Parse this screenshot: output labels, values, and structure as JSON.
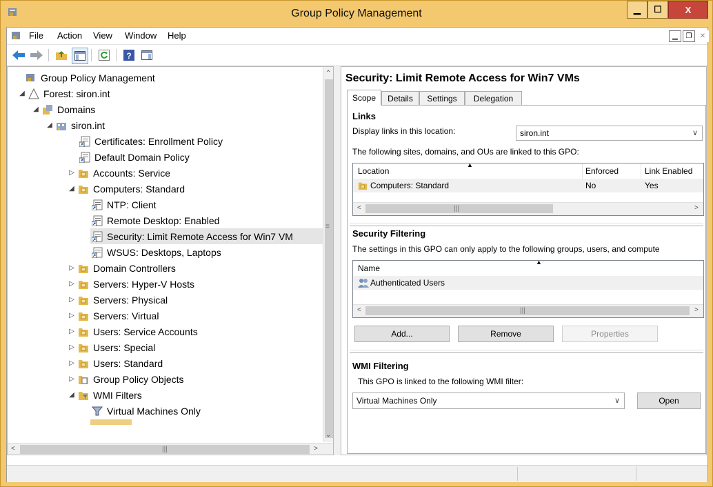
{
  "window": {
    "title": "Group Policy Management"
  },
  "menu": {
    "items": [
      {
        "label": "File",
        "key": "F"
      },
      {
        "label": "Action",
        "key": "A"
      },
      {
        "label": "View",
        "key": "V"
      },
      {
        "label": "Window",
        "key": "W"
      },
      {
        "label": "Help",
        "key": "H"
      }
    ]
  },
  "toolbar": {
    "icons": [
      "back-arrow-icon",
      "forward-arrow-icon",
      "folder-up-icon",
      "show-hide-tree-icon",
      "refresh-icon",
      "help-icon",
      "properties-pane-icon"
    ]
  },
  "tree": {
    "items": [
      {
        "label": "Group Policy Management",
        "icon": "gpm-icon",
        "expander": ""
      },
      {
        "label": "Forest: siron.int",
        "icon": "forest-icon",
        "expander": "◢"
      },
      {
        "label": "Domains",
        "icon": "domains-icon",
        "expander": "◢"
      },
      {
        "label": "siron.int",
        "icon": "domain-icon",
        "expander": "◢"
      },
      {
        "label": "Certificates: Enrollment Policy",
        "icon": "gpo-link-icon",
        "expander": ""
      },
      {
        "label": "Default Domain Policy",
        "icon": "gpo-link-icon",
        "expander": ""
      },
      {
        "label": "Accounts: Service",
        "icon": "ou-folder-icon",
        "expander": "▷"
      },
      {
        "label": "Computers: Standard",
        "icon": "ou-folder-icon",
        "expander": "◢"
      },
      {
        "label": "NTP: Client",
        "icon": "gpo-link-icon",
        "expander": ""
      },
      {
        "label": "Remote Desktop: Enabled",
        "icon": "gpo-link-icon",
        "expander": ""
      },
      {
        "label": "Security: Limit Remote Access for Win7 VM",
        "icon": "gpo-link-icon",
        "expander": ""
      },
      {
        "label": "WSUS: Desktops, Laptops",
        "icon": "gpo-link-icon",
        "expander": ""
      },
      {
        "label": "Domain Controllers",
        "icon": "ou-folder-icon",
        "expander": "▷"
      },
      {
        "label": "Servers: Hyper-V Hosts",
        "icon": "ou-folder-icon",
        "expander": "▷"
      },
      {
        "label": "Servers: Physical",
        "icon": "ou-folder-icon",
        "expander": "▷"
      },
      {
        "label": "Servers: Virtual",
        "icon": "ou-folder-icon",
        "expander": "▷"
      },
      {
        "label": "Users: Service Accounts",
        "icon": "ou-folder-icon",
        "expander": "▷"
      },
      {
        "label": "Users: Special",
        "icon": "ou-folder-icon",
        "expander": "▷"
      },
      {
        "label": "Users: Standard",
        "icon": "ou-folder-icon",
        "expander": "▷"
      },
      {
        "label": "Group Policy Objects",
        "icon": "gpo-container-icon",
        "expander": "▷"
      },
      {
        "label": "WMI Filters",
        "icon": "wmi-folder-icon",
        "expander": "◢"
      },
      {
        "label": "Virtual Machines Only",
        "icon": "wmi-filter-icon",
        "expander": ""
      }
    ],
    "selected_index": 10
  },
  "detail": {
    "title": "Security: Limit Remote Access for Win7 VMs",
    "tabs": [
      "Scope",
      "Details",
      "Settings",
      "Delegation"
    ],
    "active_tab": "Scope",
    "links": {
      "heading": "Links",
      "display_label": "Display links in this location:",
      "display_value": "siron.int",
      "description": "The following sites, domains, and OUs are linked to this GPO:",
      "columns": [
        "Location",
        "Enforced",
        "Link Enabled"
      ],
      "rows": [
        {
          "location": "Computers: Standard",
          "enforced": "No",
          "link_enabled": "Yes"
        }
      ]
    },
    "security": {
      "heading": "Security Filtering",
      "description": "The settings in this GPO can only apply to the following groups, users, and compute",
      "columns": [
        "Name"
      ],
      "rows": [
        {
          "name": "Authenticated Users"
        }
      ],
      "buttons": {
        "add": "Add...",
        "remove": "Remove",
        "properties": "Properties"
      }
    },
    "wmi": {
      "heading": "WMI Filtering",
      "description": "This GPO is linked to the following WMI filter:",
      "value": "Virtual Machines Only",
      "open_button": "Open"
    }
  },
  "colors": {
    "titlebar": "#f3c86e",
    "close_button": "#c7463b",
    "selection": "#e5e5e5"
  }
}
